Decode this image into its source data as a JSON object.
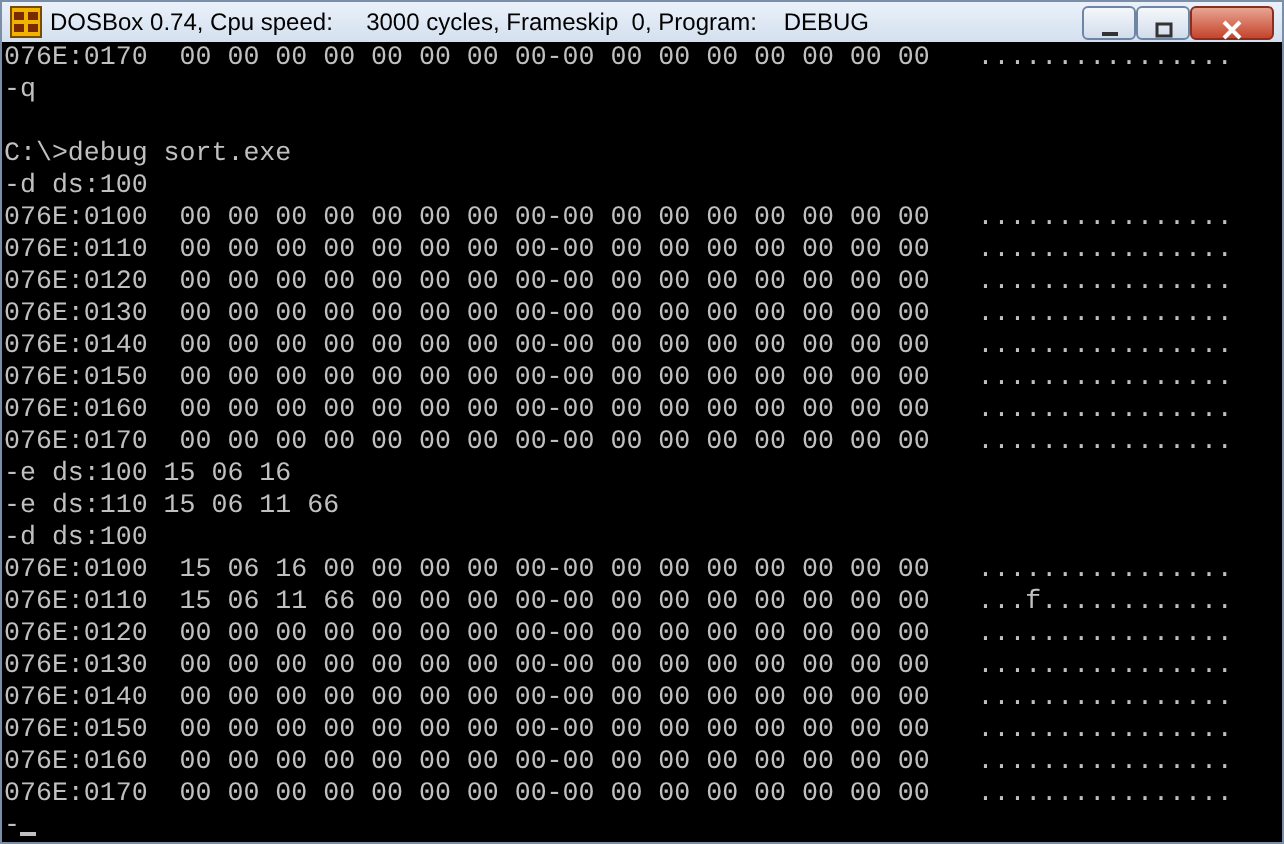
{
  "window": {
    "title": "DOSBox 0.74, Cpu speed:     3000 cycles, Frameskip  0, Program:    DEBUG"
  },
  "console": {
    "blocks": [
      [
        "076E:0170  00 00 00 00 00 00 00 00-00 00 00 00 00 00 00 00   ................",
        "-q"
      ],
      [
        "C:\\>debug sort.exe",
        "-d ds:100",
        "076E:0100  00 00 00 00 00 00 00 00-00 00 00 00 00 00 00 00   ................",
        "076E:0110  00 00 00 00 00 00 00 00-00 00 00 00 00 00 00 00   ................",
        "076E:0120  00 00 00 00 00 00 00 00-00 00 00 00 00 00 00 00   ................",
        "076E:0130  00 00 00 00 00 00 00 00-00 00 00 00 00 00 00 00   ................",
        "076E:0140  00 00 00 00 00 00 00 00-00 00 00 00 00 00 00 00   ................",
        "076E:0150  00 00 00 00 00 00 00 00-00 00 00 00 00 00 00 00   ................",
        "076E:0160  00 00 00 00 00 00 00 00-00 00 00 00 00 00 00 00   ................",
        "076E:0170  00 00 00 00 00 00 00 00-00 00 00 00 00 00 00 00   ................",
        "-e ds:100 15 06 16",
        "-e ds:110 15 06 11 66",
        "-d ds:100",
        "076E:0100  15 06 16 00 00 00 00 00-00 00 00 00 00 00 00 00   ................",
        "076E:0110  15 06 11 66 00 00 00 00-00 00 00 00 00 00 00 00   ...f............",
        "076E:0120  00 00 00 00 00 00 00 00-00 00 00 00 00 00 00 00   ................",
        "076E:0130  00 00 00 00 00 00 00 00-00 00 00 00 00 00 00 00   ................",
        "076E:0140  00 00 00 00 00 00 00 00-00 00 00 00 00 00 00 00   ................",
        "076E:0150  00 00 00 00 00 00 00 00-00 00 00 00 00 00 00 00   ................",
        "076E:0160  00 00 00 00 00 00 00 00-00 00 00 00 00 00 00 00   ................",
        "076E:0170  00 00 00 00 00 00 00 00-00 00 00 00 00 00 00 00   ................"
      ]
    ],
    "prompt": "-"
  }
}
